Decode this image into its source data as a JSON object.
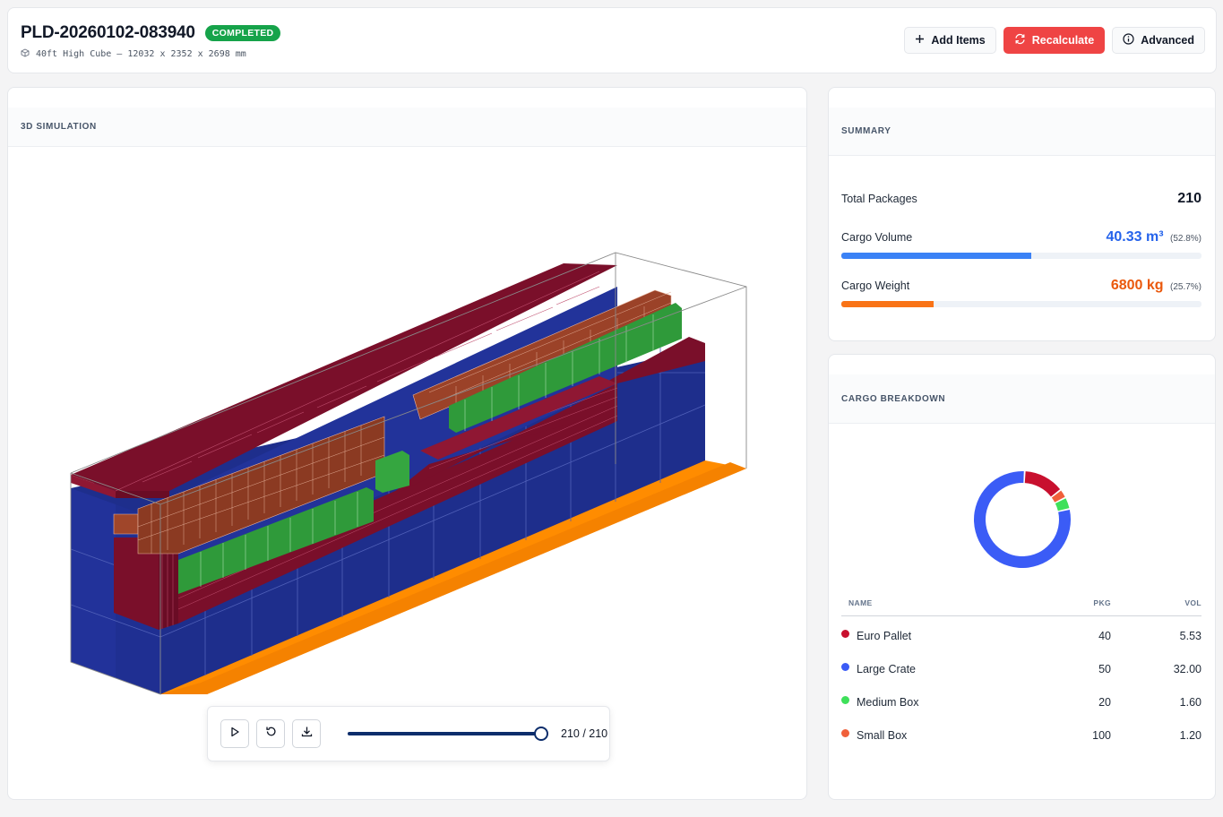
{
  "header": {
    "plan_id": "PLD-20260102-083940",
    "status": "COMPLETED",
    "container": "40ft High Cube – 12032 x 2352 x 2698 mm",
    "buttons": {
      "add_items": "Add Items",
      "recalculate": "Recalculate",
      "advanced": "Advanced"
    }
  },
  "simulation": {
    "title": "3D SIMULATION",
    "step_count": "210 / 210",
    "progress": 1.0
  },
  "summary": {
    "title": "SUMMARY",
    "total_packages_label": "Total Packages",
    "total_packages": "210",
    "cargo_volume_label": "Cargo Volume",
    "cargo_volume": "40.33 m³",
    "cargo_volume_pct": "(52.8%)",
    "cargo_volume_fraction": 0.528,
    "cargo_weight_label": "Cargo Weight",
    "cargo_weight": "6800 kg",
    "cargo_weight_pct": "(25.7%)",
    "cargo_weight_fraction": 0.257
  },
  "breakdown": {
    "title": "CARGO BREAKDOWN",
    "columns": {
      "name": "NAME",
      "pkg": "PKG",
      "vol": "VOL"
    },
    "items": [
      {
        "name": "Euro Pallet",
        "pkg": "40",
        "vol": "5.53",
        "color": "#c8102e"
      },
      {
        "name": "Large Crate",
        "pkg": "50",
        "vol": "32.00",
        "color": "#3b5cf6"
      },
      {
        "name": "Medium Box",
        "pkg": "20",
        "vol": "1.60",
        "color": "#3ee05a"
      },
      {
        "name": "Small Box",
        "pkg": "100",
        "vol": "1.20",
        "color": "#f0603a"
      }
    ]
  },
  "colors": {
    "accent_blue": "#2563eb",
    "accent_orange": "#ea580c",
    "completed_green": "#16a34a",
    "recalculate_red": "#ef4444",
    "container_floor": "#ff8c00"
  }
}
